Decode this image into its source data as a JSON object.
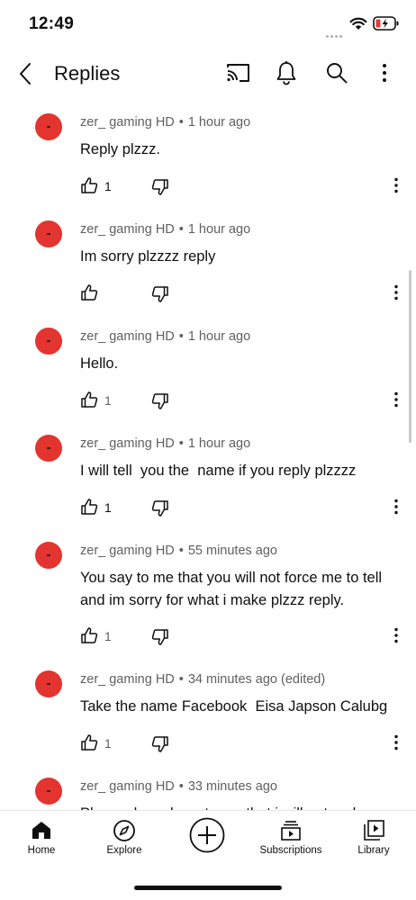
{
  "status": {
    "time": "12:49"
  },
  "header": {
    "title": "Replies"
  },
  "comments": [
    {
      "author": "zer_ gaming HD",
      "time": "1 hour ago",
      "text": "Reply plzzz.",
      "likes": "1"
    },
    {
      "author": "zer_ gaming HD",
      "time": "1 hour ago",
      "text": "Im sorry plzzzz reply",
      "likes": ""
    },
    {
      "author": "zer_ gaming HD",
      "time": "1 hour ago",
      "text": "Hello.",
      "likes": "1"
    },
    {
      "author": "zer_ gaming HD",
      "time": "1 hour ago",
      "text": "I will tell  you the  name if you reply plzzzz",
      "likes": "1"
    },
    {
      "author": "zer_ gaming HD",
      "time": "55 minutes ago",
      "text": "You say to me that you will not force me to tell and im sorry for what i make plzzz reply.",
      "likes": "1"
    },
    {
      "author": "zer_ gaming HD",
      "time": "34 minutes ago (edited)",
      "text": "Take the name Facebook  Eisa Japson Calubg",
      "likes": "1"
    },
    {
      "author": "zer_ gaming HD",
      "time": "33 minutes ago",
      "text": "Plzz reply and say to me that i will not make",
      "likes": ""
    }
  ],
  "separator": "•",
  "nav": {
    "home": "Home",
    "explore": "Explore",
    "subscriptions": "Subscriptions",
    "library": "Library"
  },
  "icons": {
    "back": "back-arrow-icon",
    "cast": "cast-icon",
    "notifications": "bell-icon",
    "search": "search-icon",
    "more": "more-vertical-icon",
    "like": "thumbs-up-icon",
    "dislike": "thumbs-down-icon",
    "create": "plus-circle-icon"
  },
  "colors": {
    "avatar": "#e3342f",
    "battery_low": "#e53935",
    "text": "#0f0f0f",
    "meta": "#606060"
  }
}
